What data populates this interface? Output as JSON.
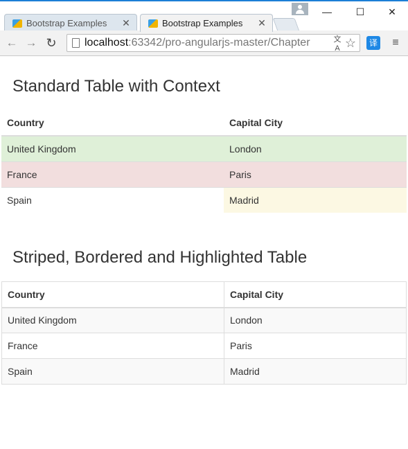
{
  "browser": {
    "tabs": [
      {
        "title": "Bootstrap Examples",
        "close": "✕"
      },
      {
        "title": "Bootstrap Examples",
        "close": "✕"
      }
    ],
    "window_controls": {
      "minimize": "—",
      "maximize": "☐",
      "close": "✕"
    },
    "nav": {
      "back": "←",
      "forward": "→",
      "reload": "↻"
    },
    "address": {
      "host": "localhost",
      "path": ":63342/pro-angularjs-master/Chapter"
    },
    "icons": {
      "translate": "文A",
      "star": "☆",
      "extension": "译",
      "menu": "≡"
    }
  },
  "page": {
    "section1": {
      "title": "Standard Table with Context",
      "headers": [
        "Country",
        "Capital City"
      ],
      "rows": [
        {
          "country": "United Kingdom",
          "capital": "London",
          "context": "success"
        },
        {
          "country": "France",
          "capital": "Paris",
          "context": "danger"
        },
        {
          "country": "Spain",
          "capital": "Madrid",
          "context": "warning-capital"
        }
      ]
    },
    "section2": {
      "title": "Striped, Bordered and Highlighted Table",
      "headers": [
        "Country",
        "Capital City"
      ],
      "rows": [
        {
          "country": "United Kingdom",
          "capital": "London"
        },
        {
          "country": "France",
          "capital": "Paris"
        },
        {
          "country": "Spain",
          "capital": "Madrid"
        }
      ]
    },
    "colors": {
      "success": "#dff0d8",
      "danger": "#f2dede",
      "warning": "#fcf8e3",
      "stripe": "#f9f9f9",
      "border": "#dddddd"
    }
  }
}
